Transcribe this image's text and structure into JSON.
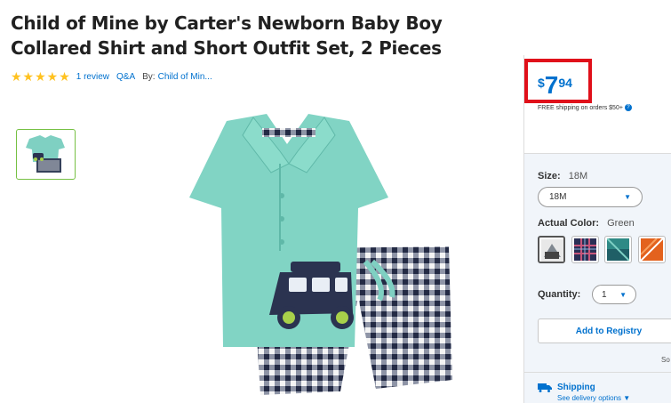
{
  "product": {
    "title": "Child of Mine by Carter's Newborn Baby Boy Collared Shirt and Short Outfit Set, 2 Pieces",
    "rating_stars": "★★★★★",
    "rating_value": 5,
    "reviews_link": "1 review",
    "qa_link": "Q&A",
    "by_label": "By:",
    "brand_link": "Child of Min..."
  },
  "price": {
    "currency": "$",
    "dollars": "7",
    "cents": "94",
    "shipping_note": "FREE shipping on orders $50+"
  },
  "options": {
    "size_label": "Size:",
    "size_value": "18M",
    "size_selected": "18M",
    "color_label": "Actual Color:",
    "color_value": "Green",
    "quantity_label": "Quantity:",
    "quantity_value": "1",
    "registry_button": "Add to Registry",
    "cut_off_text": "So"
  },
  "shipping": {
    "title": "Shipping",
    "subtitle": "See delivery options"
  },
  "colors": {
    "accent_blue": "#0071ce",
    "star_yellow": "#ffc220",
    "highlight_red": "#e0101a",
    "selected_green": "#76c043"
  },
  "icons": [
    "star-icon",
    "question-icon",
    "chevron-down-icon",
    "truck-icon"
  ]
}
